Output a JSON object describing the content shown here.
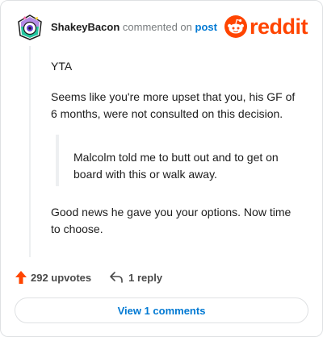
{
  "comment": {
    "author": "ShakeyBacon",
    "action_text": "commented on",
    "post_link": "post",
    "paragraphs": [
      "YTA",
      "Seems like you're more upset that you, his GF of 6 months, were not consulted on this decision.",
      "Good news he gave you your options. Now time to choose."
    ],
    "quote": "Malcolm told me to butt out and to get on board with this or walk away."
  },
  "brand": {
    "name": "reddit",
    "color": "#ff4500"
  },
  "actions": {
    "upvotes": "292 upvotes",
    "replies": "1 reply"
  },
  "footer": {
    "view_comments": "View 1 comments"
  },
  "colors": {
    "accent": "#0079d3",
    "upvote": "#ff4500",
    "border": "#dfe1e3"
  },
  "icons": {
    "avatar": "snoo-avatar-icon",
    "logo": "reddit-snoo-icon",
    "upvote": "upvote-arrow-icon",
    "reply": "reply-arrow-icon"
  }
}
